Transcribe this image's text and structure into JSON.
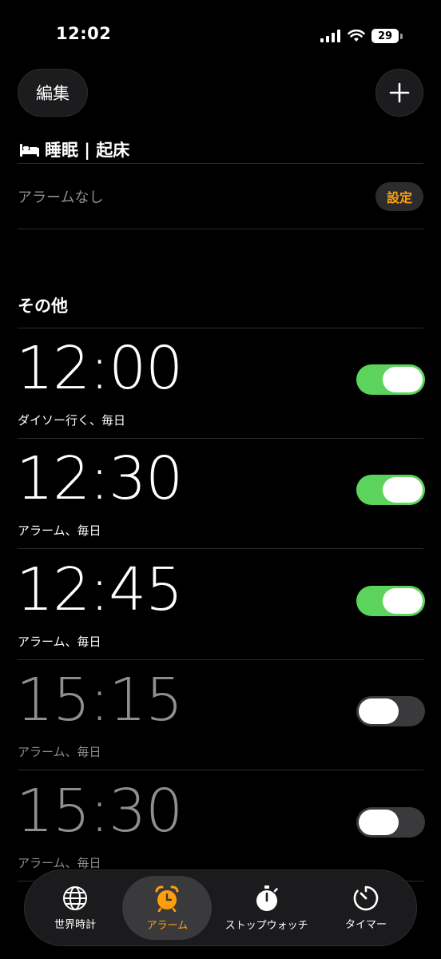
{
  "status_bar": {
    "time": "12:02",
    "battery": "29"
  },
  "header": {
    "edit_label": "編集"
  },
  "sleep": {
    "title": "睡眠 | 起床",
    "no_alarm": "アラームなし",
    "settings_label": "設定"
  },
  "other": {
    "title": "その他"
  },
  "alarms": [
    {
      "time": "12:00",
      "label": "ダイソー行く、毎日",
      "enabled": true
    },
    {
      "time": "12:30",
      "label": "アラーム、毎日",
      "enabled": true
    },
    {
      "time": "12:45",
      "label": "アラーム、毎日",
      "enabled": true
    },
    {
      "time": "15:15",
      "label": "アラーム、毎日",
      "enabled": false
    },
    {
      "time": "15:30",
      "label": "アラーム、毎日",
      "enabled": false
    }
  ],
  "tabs": [
    {
      "label": "世界時計",
      "icon": "globe-icon"
    },
    {
      "label": "アラーム",
      "icon": "alarm-clock-icon",
      "active": true
    },
    {
      "label": "ストップウォッチ",
      "icon": "stopwatch-icon"
    },
    {
      "label": "タイマー",
      "icon": "timer-icon"
    }
  ],
  "colors": {
    "accent": "#ff9f0a",
    "toggle_on": "#5cd35c",
    "toggle_off": "#3a3a3c",
    "background": "#000000"
  }
}
